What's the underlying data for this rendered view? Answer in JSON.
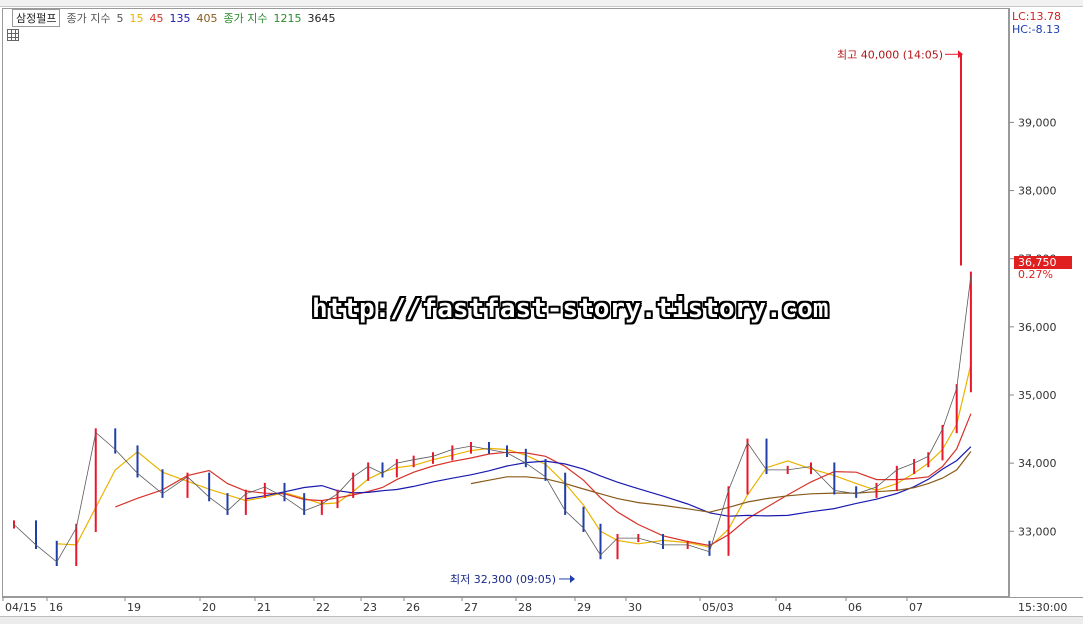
{
  "legend": {
    "symbol": "삼정펄프",
    "close_price_label": "종가 지수",
    "short_ma_periods": [
      "5",
      "15",
      "45",
      "135",
      "405"
    ],
    "long_close_price_label": "종가 지수",
    "long_ma_periods": [
      "1215",
      "3645"
    ]
  },
  "readouts": {
    "lc": "LC:13.78",
    "hc": "HC:-8.13",
    "current_price": "36,750",
    "current_change": "0.27%",
    "last_time": "15:30:00"
  },
  "watermark": "http://fastfast-story.tistory.com",
  "colors": {
    "up": "#e8172b",
    "down": "#1f3ea8",
    "ma5": "#e8b400",
    "ma15": "#d8322a",
    "ma45": "#8b2b1e",
    "ma135": "#1a1ab0",
    "ma405": "#8a5a1a",
    "ma1215": "#2a8a2a",
    "ma3645": "#222222"
  },
  "chart_data": {
    "type": "line",
    "title": "",
    "xlabel": "",
    "ylabel": "",
    "ylim": [
      32050,
      40650
    ],
    "yticks": [
      33000,
      34000,
      35000,
      36000,
      37000,
      38000,
      39000
    ],
    "ytick_labels": [
      "33,000",
      "34,000",
      "35,000",
      "36,000",
      "37,000",
      "38,000",
      "39,000"
    ],
    "xticks": [
      "04/15",
      "16",
      "19",
      "20",
      "21",
      "22",
      "23",
      "26",
      "27",
      "28",
      "29",
      "30",
      "05/03",
      "04",
      "06",
      "07"
    ],
    "x": [
      "04/15",
      "04/15",
      "04/16",
      "04/16",
      "04/16",
      "04/16",
      "04/19",
      "04/19",
      "04/19",
      "04/20",
      "04/20",
      "04/20",
      "04/21",
      "04/21",
      "04/21",
      "04/22",
      "04/22",
      "04/22",
      "04/23",
      "04/23",
      "04/23",
      "04/26",
      "04/26",
      "04/26",
      "04/27",
      "04/27",
      "04/27",
      "04/28",
      "04/28",
      "04/28",
      "04/29",
      "04/29",
      "04/29",
      "04/30",
      "04/30",
      "04/30",
      "05/03",
      "05/03",
      "05/03",
      "05/03",
      "05/04",
      "05/04",
      "05/04",
      "05/06",
      "05/06",
      "05/06",
      "05/07",
      "05/07",
      "05/07",
      "05/07",
      "05/07"
    ],
    "series": [
      {
        "name": "종가",
        "values": [
          33100,
          32800,
          32550,
          33050,
          34450,
          34200,
          33850,
          33550,
          33800,
          33500,
          33300,
          33550,
          33650,
          33500,
          33300,
          33400,
          33550,
          33800,
          33950,
          33850,
          34000,
          34050,
          34100,
          34200,
          34250,
          34200,
          34150,
          34000,
          33800,
          33300,
          33050,
          32650,
          32900,
          32900,
          32800,
          32800,
          32700,
          33600,
          34300,
          33900,
          33900,
          33950,
          33600,
          33550,
          33650,
          33900,
          34000,
          34100,
          34500,
          35100,
          36750
        ]
      },
      {
        "name": "405",
        "values": [
          null,
          null,
          null,
          null,
          null,
          null,
          null,
          null,
          null,
          null,
          null,
          null,
          null,
          null,
          null,
          null,
          null,
          null,
          null,
          null,
          null,
          null,
          null,
          null,
          33700,
          33750,
          33800,
          33800,
          33770,
          33700,
          33620,
          33550,
          33480,
          33420,
          33380,
          33330,
          33280,
          33350,
          33430,
          33480,
          33520,
          33550,
          33560,
          33560,
          33580,
          33600,
          33640,
          33700,
          33780,
          33900,
          34170
        ]
      }
    ],
    "annotations": [
      {
        "text": "최고 40,000 (14:05)",
        "value": 40000
      },
      {
        "text": "최저 32,300 (09:05)",
        "value": 32300
      }
    ]
  }
}
